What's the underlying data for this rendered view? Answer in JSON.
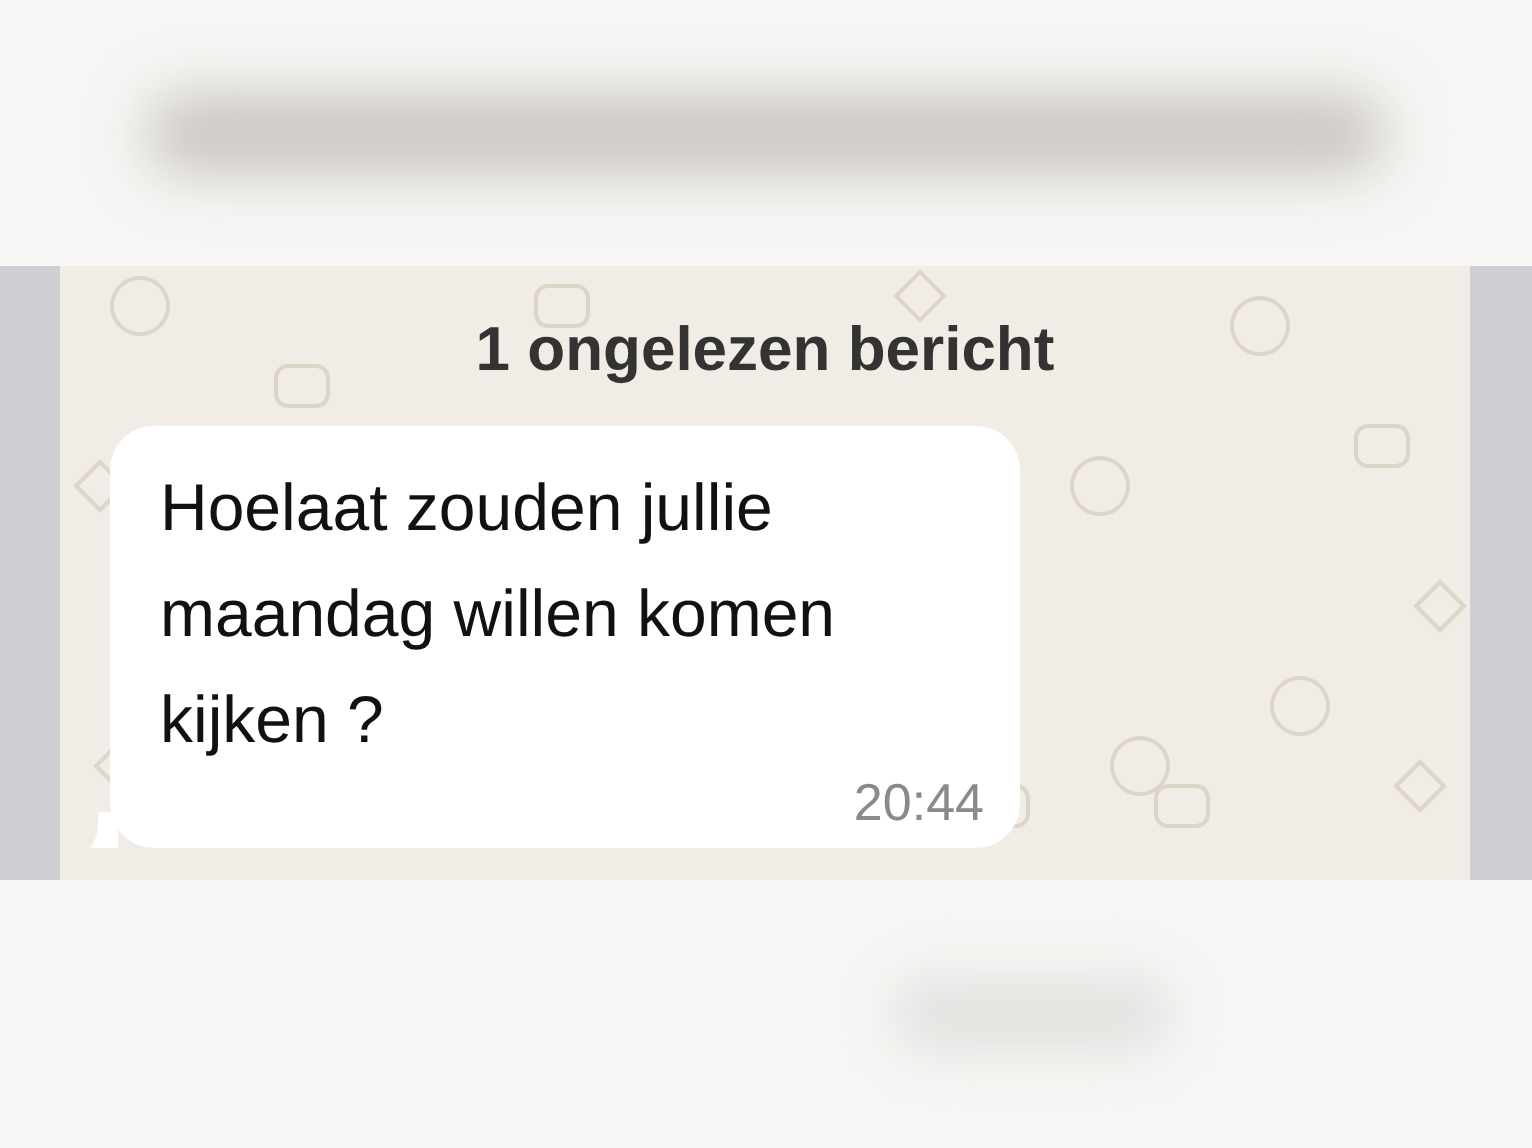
{
  "unread_divider": {
    "text": "1 ongelezen bericht"
  },
  "messages": [
    {
      "text": "Hoelaat zouden jullie maandag willen komen kijken ?",
      "time": "20:44"
    }
  ]
}
